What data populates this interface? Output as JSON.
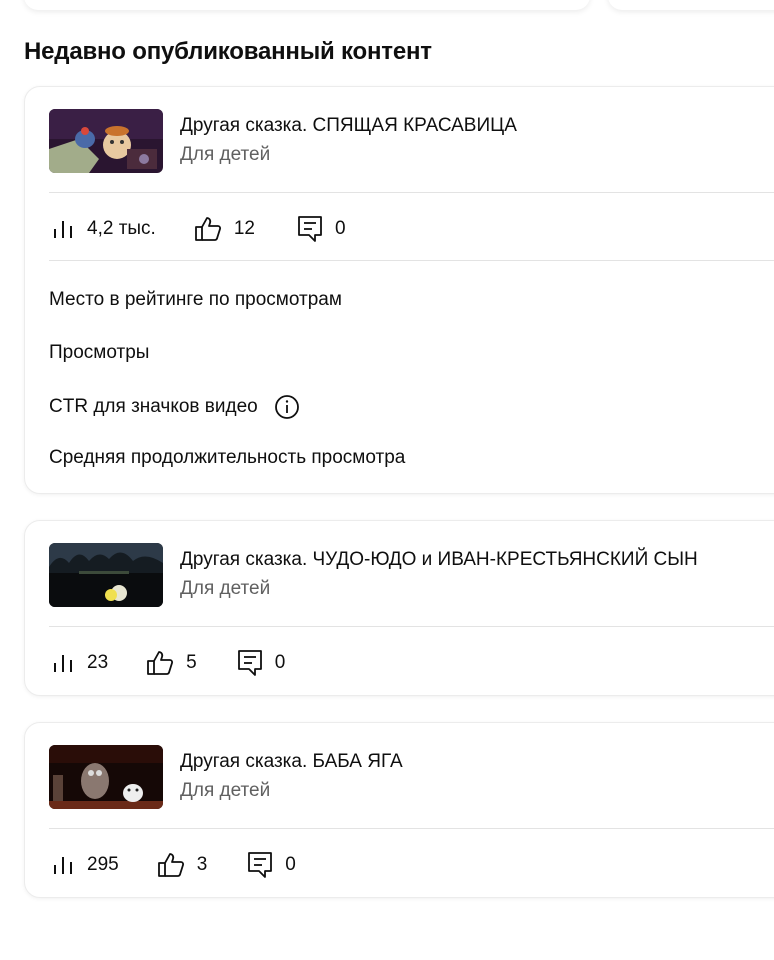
{
  "section_title": "Недавно опубликованный контент",
  "videos": [
    {
      "title": "Другая сказка. СПЯЩАЯ КРАСАВИЦА",
      "category": "Для детей",
      "views": "4,2 тыс.",
      "likes": "12",
      "comments": "0"
    },
    {
      "title": "Другая сказка.  ЧУДО-ЮДО и ИВАН-КРЕСТЬЯНСКИЙ СЫН",
      "category": "Для детей",
      "views": "23",
      "likes": "5",
      "comments": "0"
    },
    {
      "title": "Другая сказка. БАБА ЯГА",
      "category": "Для детей",
      "views": "295",
      "likes": "3",
      "comments": "0"
    }
  ],
  "metrics": [
    "Место в рейтинге по просмотрам",
    "Просмотры",
    "CTR для значков видео",
    "Средняя продолжительность просмотра"
  ],
  "icons": {
    "views": "bar-chart-icon",
    "likes": "thumbs-up-icon",
    "comments": "comment-icon",
    "info": "info-icon"
  }
}
